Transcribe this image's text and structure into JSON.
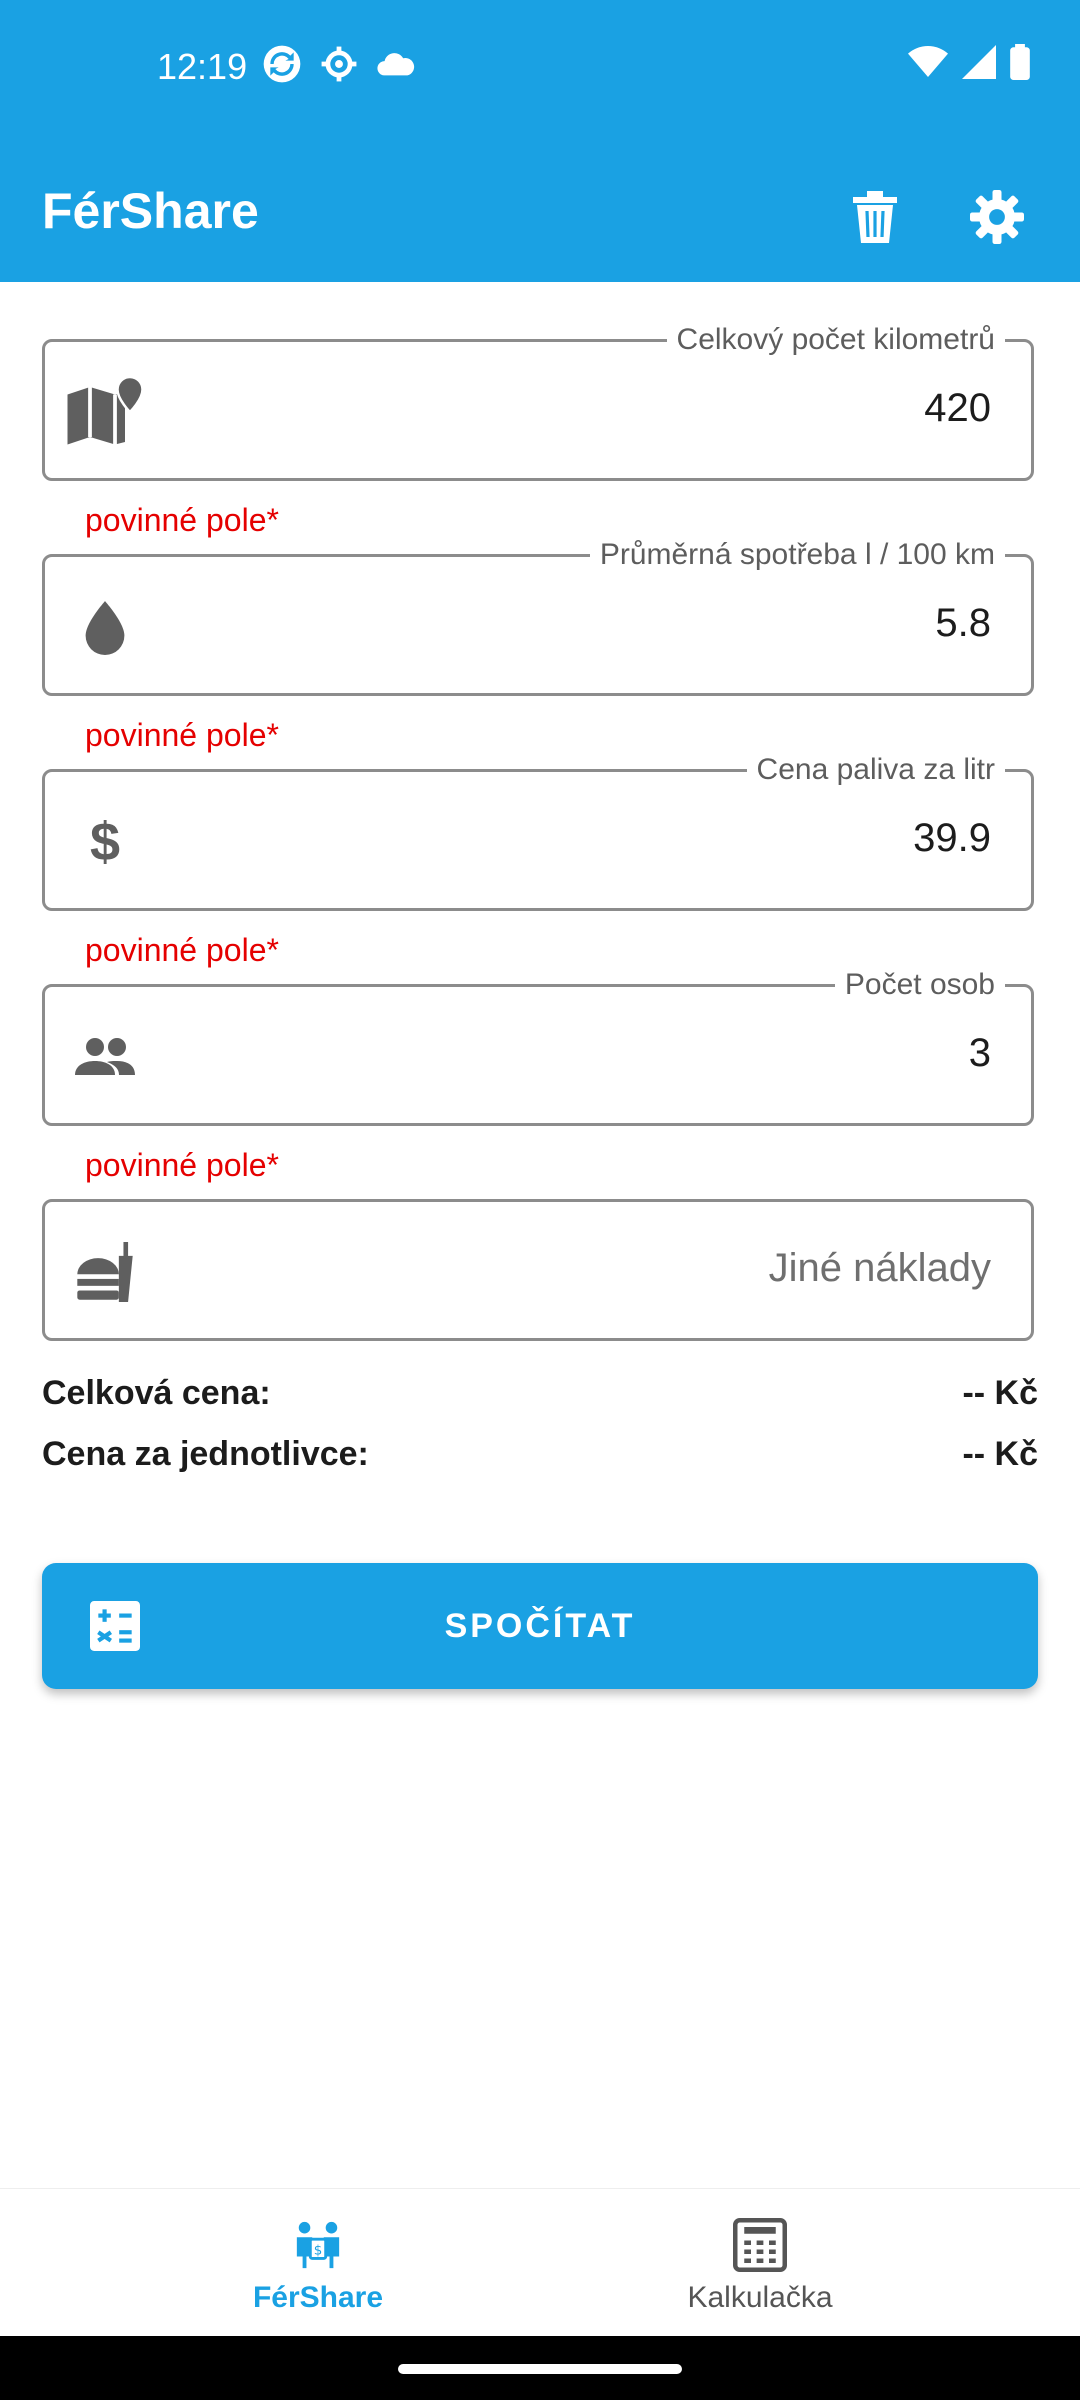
{
  "status": {
    "time": "12:19",
    "left_icons": [
      "sync-icon",
      "settings-gear-icon",
      "cloud-icon"
    ],
    "right_icons": [
      "wifi-icon",
      "signal-icon",
      "battery-icon"
    ]
  },
  "appbar": {
    "title": "FérShare",
    "actions": [
      "trash-icon",
      "gear-icon"
    ]
  },
  "form": {
    "fields": [
      {
        "label": "Celkový počet kilometrů",
        "value": "420",
        "icon": "map-icon",
        "required_text": "povinné pole*"
      },
      {
        "label": "Průměrná spotřeba l / 100 km",
        "value": "5.8",
        "icon": "drop-icon",
        "required_text": "povinné pole*"
      },
      {
        "label": "Cena paliva za litr",
        "value": "39.9",
        "icon": "dollar-icon",
        "required_text": "povinné pole*"
      },
      {
        "label": "Počet osob",
        "value": "3",
        "icon": "people-icon",
        "required_text": "povinné pole*"
      },
      {
        "placeholder": "Jiné náklady",
        "icon": "food-icon"
      }
    ]
  },
  "summary": {
    "total_label": "Celková cena:",
    "total_value": "-- Kč",
    "per_person_label": "Cena za jednotlivce:",
    "per_person_value": "-- Kč"
  },
  "calc_button": {
    "label": "SPOČÍTAT",
    "icon": "calculator-icon"
  },
  "bottom_nav": [
    {
      "label": "FérShare",
      "icon": "fershare-icon",
      "active": true
    },
    {
      "label": "Kalkulačka",
      "icon": "calculator-grid-icon",
      "active": false
    }
  ],
  "colors": {
    "primary": "#1aa1e3",
    "error": "#e50000"
  }
}
